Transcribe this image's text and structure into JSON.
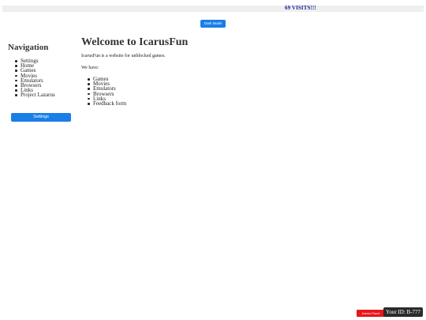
{
  "header": {
    "visits": "69 VISITS!!!",
    "dark_mode_label": "Dark Mode"
  },
  "nav": {
    "title": "Navigation",
    "items": [
      "Settings",
      "Home",
      "Games",
      "Movies",
      "Emulators",
      "Browsers",
      "Links",
      "Project Lazarus"
    ],
    "settings_button": "Settings"
  },
  "main": {
    "title": "Welcome to IcarusFun",
    "intro": "IcarusFun is a website for unblocked games.",
    "have": "We have:",
    "items": [
      "Games",
      "Movies",
      "Emulators",
      "Browsers",
      "Links",
      "Feedback form"
    ]
  },
  "footer": {
    "admin_label": "Admin Panel",
    "user_id": "Your ID: B-777"
  },
  "colors": {
    "button_blue": "#1a7ee8",
    "admin_red": "#e8161b",
    "visits_text": "#1b1b99"
  }
}
